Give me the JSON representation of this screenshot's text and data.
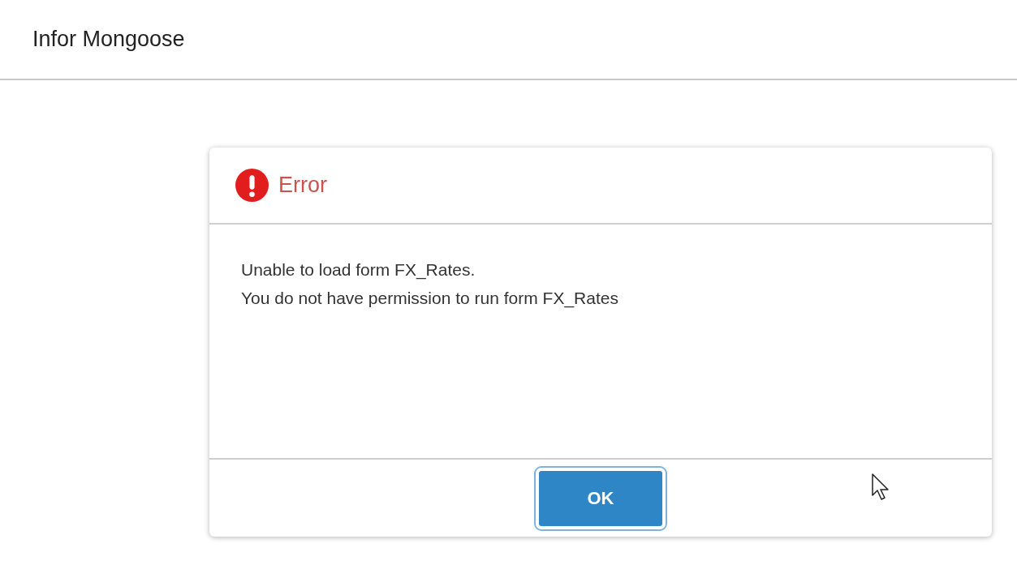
{
  "app_bar": {
    "title": "Infor Mongoose"
  },
  "dialog": {
    "kind": "error",
    "title": "Error",
    "message_lines": [
      "Unable to load form FX_Rates.",
      "You do not have permission to run form FX_Rates"
    ],
    "buttons": [
      {
        "label": "OK",
        "focused": true
      }
    ]
  }
}
